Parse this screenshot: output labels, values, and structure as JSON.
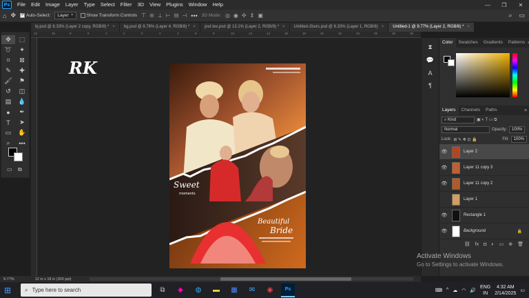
{
  "menubar": {
    "app_icon": "Ps",
    "items": [
      "File",
      "Edit",
      "Image",
      "Layer",
      "Type",
      "Select",
      "Filter",
      "3D",
      "View",
      "Plugins",
      "Window",
      "Help"
    ]
  },
  "options": {
    "auto_select_label": "Auto-Select:",
    "auto_select_value": "Layer",
    "transform_label": "Show Transform Controls",
    "mode_3d": "3D Mode:"
  },
  "tabs": [
    {
      "label": "bj.psd @ 8.33% (Layer 2 copy, RGB/8) *",
      "active": false
    },
    {
      "label": "bg.psd @ 8.76% (Layer 4, RGB/8) *",
      "active": false
    },
    {
      "label": "psd tex.psd @ 13.1% (Layer 2, RGB/8) *",
      "active": false
    },
    {
      "label": "Untitled-2burs.psd @ 8.33% (Layer 1, RGB/8)",
      "active": false
    },
    {
      "label": "Untitled-1 @ 9.77% (Layer 2, RGB/8) *",
      "active": true
    }
  ],
  "ruler_ticks": [
    "12",
    "10",
    "8",
    "6",
    "4",
    "2",
    "0",
    "2",
    "4",
    "6",
    "8",
    "10",
    "12",
    "14",
    "16",
    "18",
    "20",
    "22",
    "24",
    "26",
    "28",
    "30"
  ],
  "workspace": {
    "overlay_text": "RK"
  },
  "artwork": {
    "script_left_1": "Sweet",
    "script_left_2": "moments",
    "script_right_1": "Beautiful",
    "script_right_2": "Bride"
  },
  "status": {
    "zoom": "9.77%",
    "doc_size": "12 in x 18 in (300 ppi)"
  },
  "color_panel": {
    "tabs": [
      "Color",
      "Swatches",
      "Gradients",
      "Patterns"
    ]
  },
  "layers_panel": {
    "tabs": [
      "Layers",
      "Channels",
      "Paths"
    ],
    "kind_label": "Kind",
    "blend_mode": "Normal",
    "opacity_label": "Opacity:",
    "opacity_value": "100%",
    "lock_label": "Lock:",
    "fill_label": "Fill:",
    "fill_value": "100%",
    "layers": [
      {
        "name": "Layer 2",
        "visible": true,
        "selected": true,
        "thumb": "#b5451f"
      },
      {
        "name": "Layer 11 copy 3",
        "visible": true,
        "selected": false,
        "thumb": "#c06030"
      },
      {
        "name": "Layer 11 copy 2",
        "visible": true,
        "selected": false,
        "thumb": "#b05a2a"
      },
      {
        "name": "Layer 1",
        "visible": false,
        "selected": false,
        "thumb": "#d0a060"
      },
      {
        "name": "Rectangle 1",
        "visible": true,
        "selected": false,
        "thumb": "#111111"
      },
      {
        "name": "Background",
        "visible": true,
        "selected": false,
        "thumb": "#ffffff",
        "locked": true
      }
    ]
  },
  "activation": {
    "title": "Activate Windows",
    "subtitle": "Go to Settings to activate Windows."
  },
  "taskbar": {
    "search_placeholder": "Type here to search",
    "lang_1": "ENG",
    "lang_2": "IN",
    "time": "4:32 AM",
    "date": "2/14/2025"
  }
}
